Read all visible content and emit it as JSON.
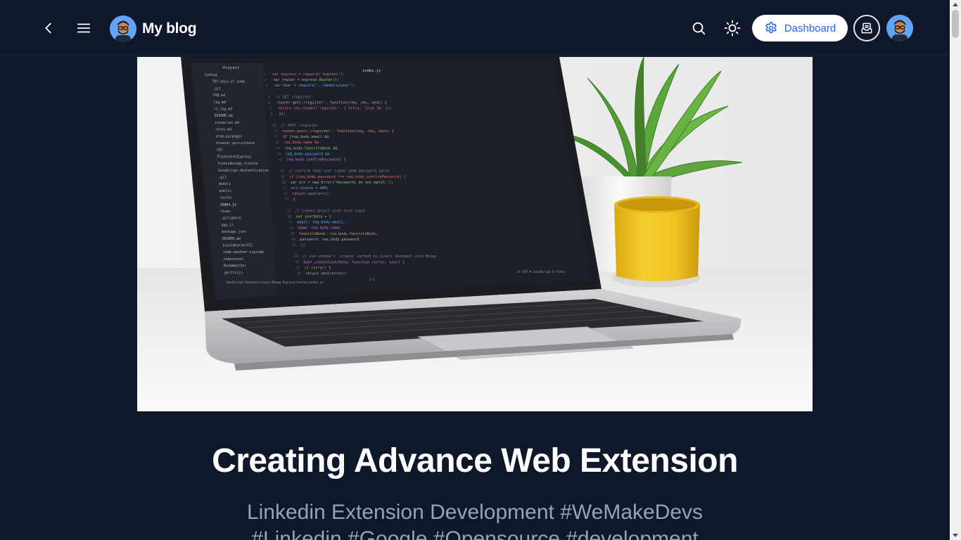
{
  "header": {
    "brand_title": "My blog",
    "dashboard_label": "Dashboard"
  },
  "post": {
    "title": "Creating Advance Web Extension",
    "subtitle_line1": "Linkedin Extension Development #WeMakeDevs",
    "subtitle_line2": "#Linkedin #Google #Opensource #development"
  },
  "cover_code": {
    "tab_title": "index.js",
    "panel_title": "Project",
    "tree": [
      "Coding",
      "TDS-days-of-code",
      ".git",
      "FAQ.md",
      "log.md",
      "r1-log.md",
      "README.md",
      "resources.md",
      "rules.md",
      "atom-packages",
      "browser_persistence",
      "c01",
      "FlashcardsExpress",
      "freecodecamp_tribute",
      "JavaScript-Authentication",
      ".git",
      "models",
      "public",
      "routes",
      "index.js",
      "views",
      ".gitignore",
      "app.js",
      "package.json",
      "README.md",
      "LocalWeatherFCC",
      "node-weather-zipcode",
      "nodeschool",
      "NodeWeather",
      "portfolio"
    ],
    "lines": [
      "var express = require('express');",
      "var router = express.Router();",
      "var User = require('../models/user');",
      "",
      "// GET /register",
      "router.get('/register', function(req, res, next) {",
      "  return res.render('register', { title: 'Sign Up' });",
      "});",
      "",
      "// POST /register",
      "router.post('/register', function(req, res, next) {",
      "  if (req.body.email &&",
      "    req.body.name &&",
      "    req.body.favoriteBook &&",
      "    req.body.password &&",
      "    req.body.confirmPassword) {",
      "",
      "      // confirm that user typed same password twice",
      "      if (req.body.password !== req.body.confirmPassword) {",
      "        var err = new Error('Passwords do not match.');",
      "        err.status = 400;",
      "        return next(err);",
      "      }",
      "",
      "      // create object with form input",
      "      var userData = {",
      "        email: req.body.email,",
      "        name: req.body.name,",
      "        favoriteBook: req.body.favoriteBook,",
      "        password: req.body.password",
      "      };",
      "",
      "      // use schema's `create` method to insert document into Mongo",
      "      User.create(userData, function (error, user) {",
      "        if (error) {",
      "          return next(error);"
    ],
    "status_path": "JavaScript-Authentication-Mongo-Express/routes/index.js",
    "status_pos": "1:1",
    "status_right": "LF   UTF-8   JavaScript   0 files"
  }
}
